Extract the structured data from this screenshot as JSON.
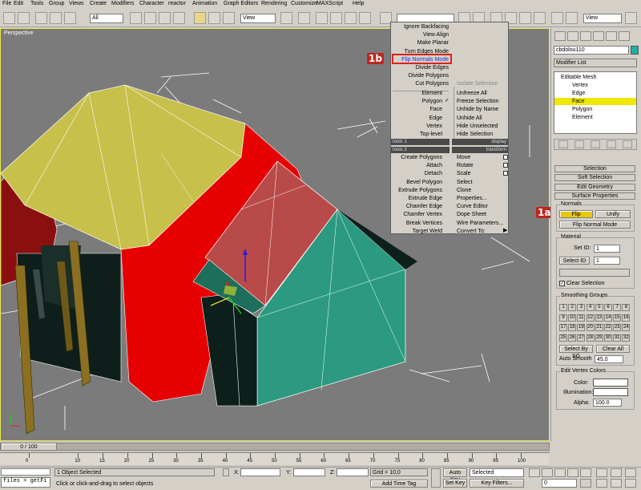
{
  "menu": [
    "File",
    "Edit",
    "Tools",
    "Group",
    "Views",
    "Create",
    "Modifiers",
    "Character",
    "reactor",
    "Animation",
    "Graph Editors",
    "Rendering",
    "Customize",
    "MAXScript",
    "Help"
  ],
  "toolbar": {
    "filter_value": "All",
    "refcoord_value": "View",
    "namedsel_value": "",
    "render_value": "View"
  },
  "viewport": {
    "label": "Perspective"
  },
  "quad": {
    "left_top": [
      "Ignore Backfacing",
      "View Align",
      "Make Planar",
      "Turn Edges Mode",
      "Flip Normals Mode",
      "Divide Edges",
      "Divide Polygons",
      "Cut Polygons"
    ],
    "right_top_header": "Isolate Selection",
    "right_top": [
      "Unfreeze All",
      "Freeze Selection",
      "Unhide by Name",
      "Unhide All",
      "Hide Unselected",
      "Hide Selection"
    ],
    "left_sub": [
      "Element",
      "Polygon",
      "Face",
      "Edge",
      "Vertex",
      "Top-level"
    ],
    "hdr_tools1": "tools 1",
    "hdr_display": "display",
    "hdr_tools2": "tools 2",
    "hdr_transform": "transform",
    "left_bottom": [
      "Create Polygons",
      "Attach",
      "Detach",
      "Bevel Polygon",
      "Extrude Polygons",
      "Extrude Edge",
      "Chamfer Edge",
      "Chamfer Vertex",
      "Break Vertices",
      "Target Weld"
    ],
    "right_bottom": [
      "Move",
      "Rotate",
      "Scale",
      "Select",
      "Clone",
      "Properties...",
      "Curve Editor",
      "Dope Sheet",
      "Wire Parameters...",
      "Convert To:"
    ]
  },
  "annotations": {
    "a1": "1a",
    "b1": "1b"
  },
  "cmdpanel": {
    "object_name": "cbdolou110",
    "modifier_list": "Modifier List",
    "stack": [
      "Editable Mesh",
      "Vertex",
      "Edge",
      "Face",
      "Polygon",
      "Element"
    ],
    "rollouts": [
      "Selection",
      "Soft Selection",
      "Edit Geometry",
      "Surface Properties"
    ],
    "normals_label": "Normals",
    "flip_button": "Flip",
    "unify_button": "Unify",
    "flip_mode_button": "Flip Normal Mode",
    "material_label": "Material",
    "set_id_label": "Set ID:",
    "set_id_value": "1",
    "select_id_label": "Select ID",
    "select_id_value": "1",
    "clear_selection": "Clear Selection",
    "smoothing_label": "Smoothing Groups",
    "smoothing": [
      "1",
      "2",
      "3",
      "4",
      "5",
      "6",
      "7",
      "8",
      "9",
      "10",
      "11",
      "12",
      "13",
      "14",
      "15",
      "16",
      "17",
      "18",
      "19",
      "20",
      "21",
      "22",
      "23",
      "24",
      "25",
      "26",
      "27",
      "28",
      "29",
      "30",
      "31",
      "32"
    ],
    "select_by_sg": "Select By SG",
    "clear_all": "Clear All",
    "auto_smooth": "Auto Smooth",
    "auto_smooth_value": "45.0",
    "vertex_colors_label": "Edit Vertex Colors",
    "color_label": "Color:",
    "illum_label": "Illumination:",
    "alpha_label": "Alpha:",
    "alpha_value": "100.0"
  },
  "timeline": {
    "frame": "0 / 100",
    "ticks": [
      "0",
      "10",
      "15",
      "20",
      "25",
      "30",
      "35",
      "40",
      "45",
      "50",
      "55",
      "60",
      "65",
      "70",
      "75",
      "80",
      "85",
      "90",
      "95",
      "100"
    ]
  },
  "status": {
    "listener": "files = getFi",
    "objects": "1 Object Selected",
    "prompt": "Click or click-and-drag to select objects",
    "x_label": "X:",
    "y_label": "Y:",
    "z_label": "Z:",
    "grid": "Grid = 10,0",
    "add_time_tag": "Add Time Tag",
    "auto_key": "Auto Key",
    "set_key": "Set Key",
    "selected": "Selected",
    "key_filters": "Key Filters...",
    "frame_value": "0"
  }
}
